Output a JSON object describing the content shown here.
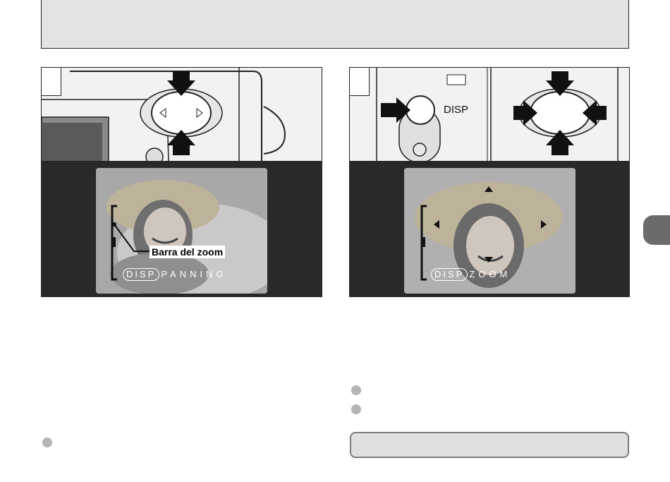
{
  "figure_left": {
    "zoom_bar_label": "Barra del zoom",
    "osd_button": "DISP",
    "osd_mode": "PANNING"
  },
  "figure_right": {
    "camera_button_label": "DISP",
    "osd_button": "DISP",
    "osd_mode": "ZOOM"
  },
  "colors": {
    "header_fill": "#e3e3e3",
    "dark_band": "#2a2828",
    "bullet": "#b4b4b4",
    "tab": "#6b6b6b"
  }
}
